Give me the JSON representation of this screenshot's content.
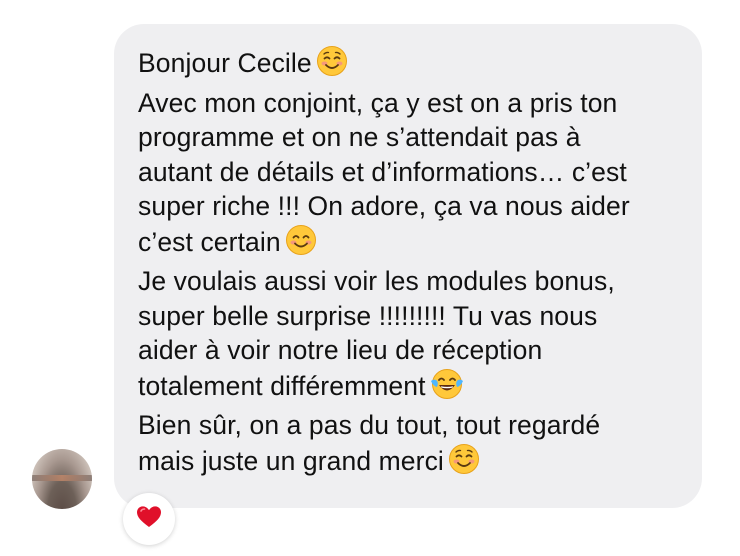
{
  "message": {
    "lines": [
      {
        "text": "Bonjour Cecile",
        "emoji": "smiling-face-icon"
      },
      {
        "text": "Avec mon conjoint, ça y est on a pris ton"
      },
      {
        "text": "programme et on ne s’attendait pas à"
      },
      {
        "text": "autant de détails et d’informations… c’est"
      },
      {
        "text": "super riche !!! On adore, ça va nous aider"
      },
      {
        "text": "c’est certain",
        "emoji": "smiling-eyes-face-icon"
      },
      {
        "text": "Je voulais aussi voir les modules bonus,"
      },
      {
        "text": "super belle surprise !!!!!!!!! Tu vas nous"
      },
      {
        "text": "aider à voir notre lieu de réception"
      },
      {
        "text": "totalement différemment",
        "emoji": "tears-of-joy-face-icon"
      },
      {
        "text": "Bien sûr, on a pas du tout, tout regardé"
      },
      {
        "text": "mais juste un grand merci",
        "emoji": "smiling-face-icon"
      }
    ]
  },
  "reaction": {
    "icon": "red-heart-icon"
  },
  "colors": {
    "bubble": "#efeff1",
    "text": "#111111",
    "heart": "#e0102a",
    "emoji": "#ffc83a"
  }
}
